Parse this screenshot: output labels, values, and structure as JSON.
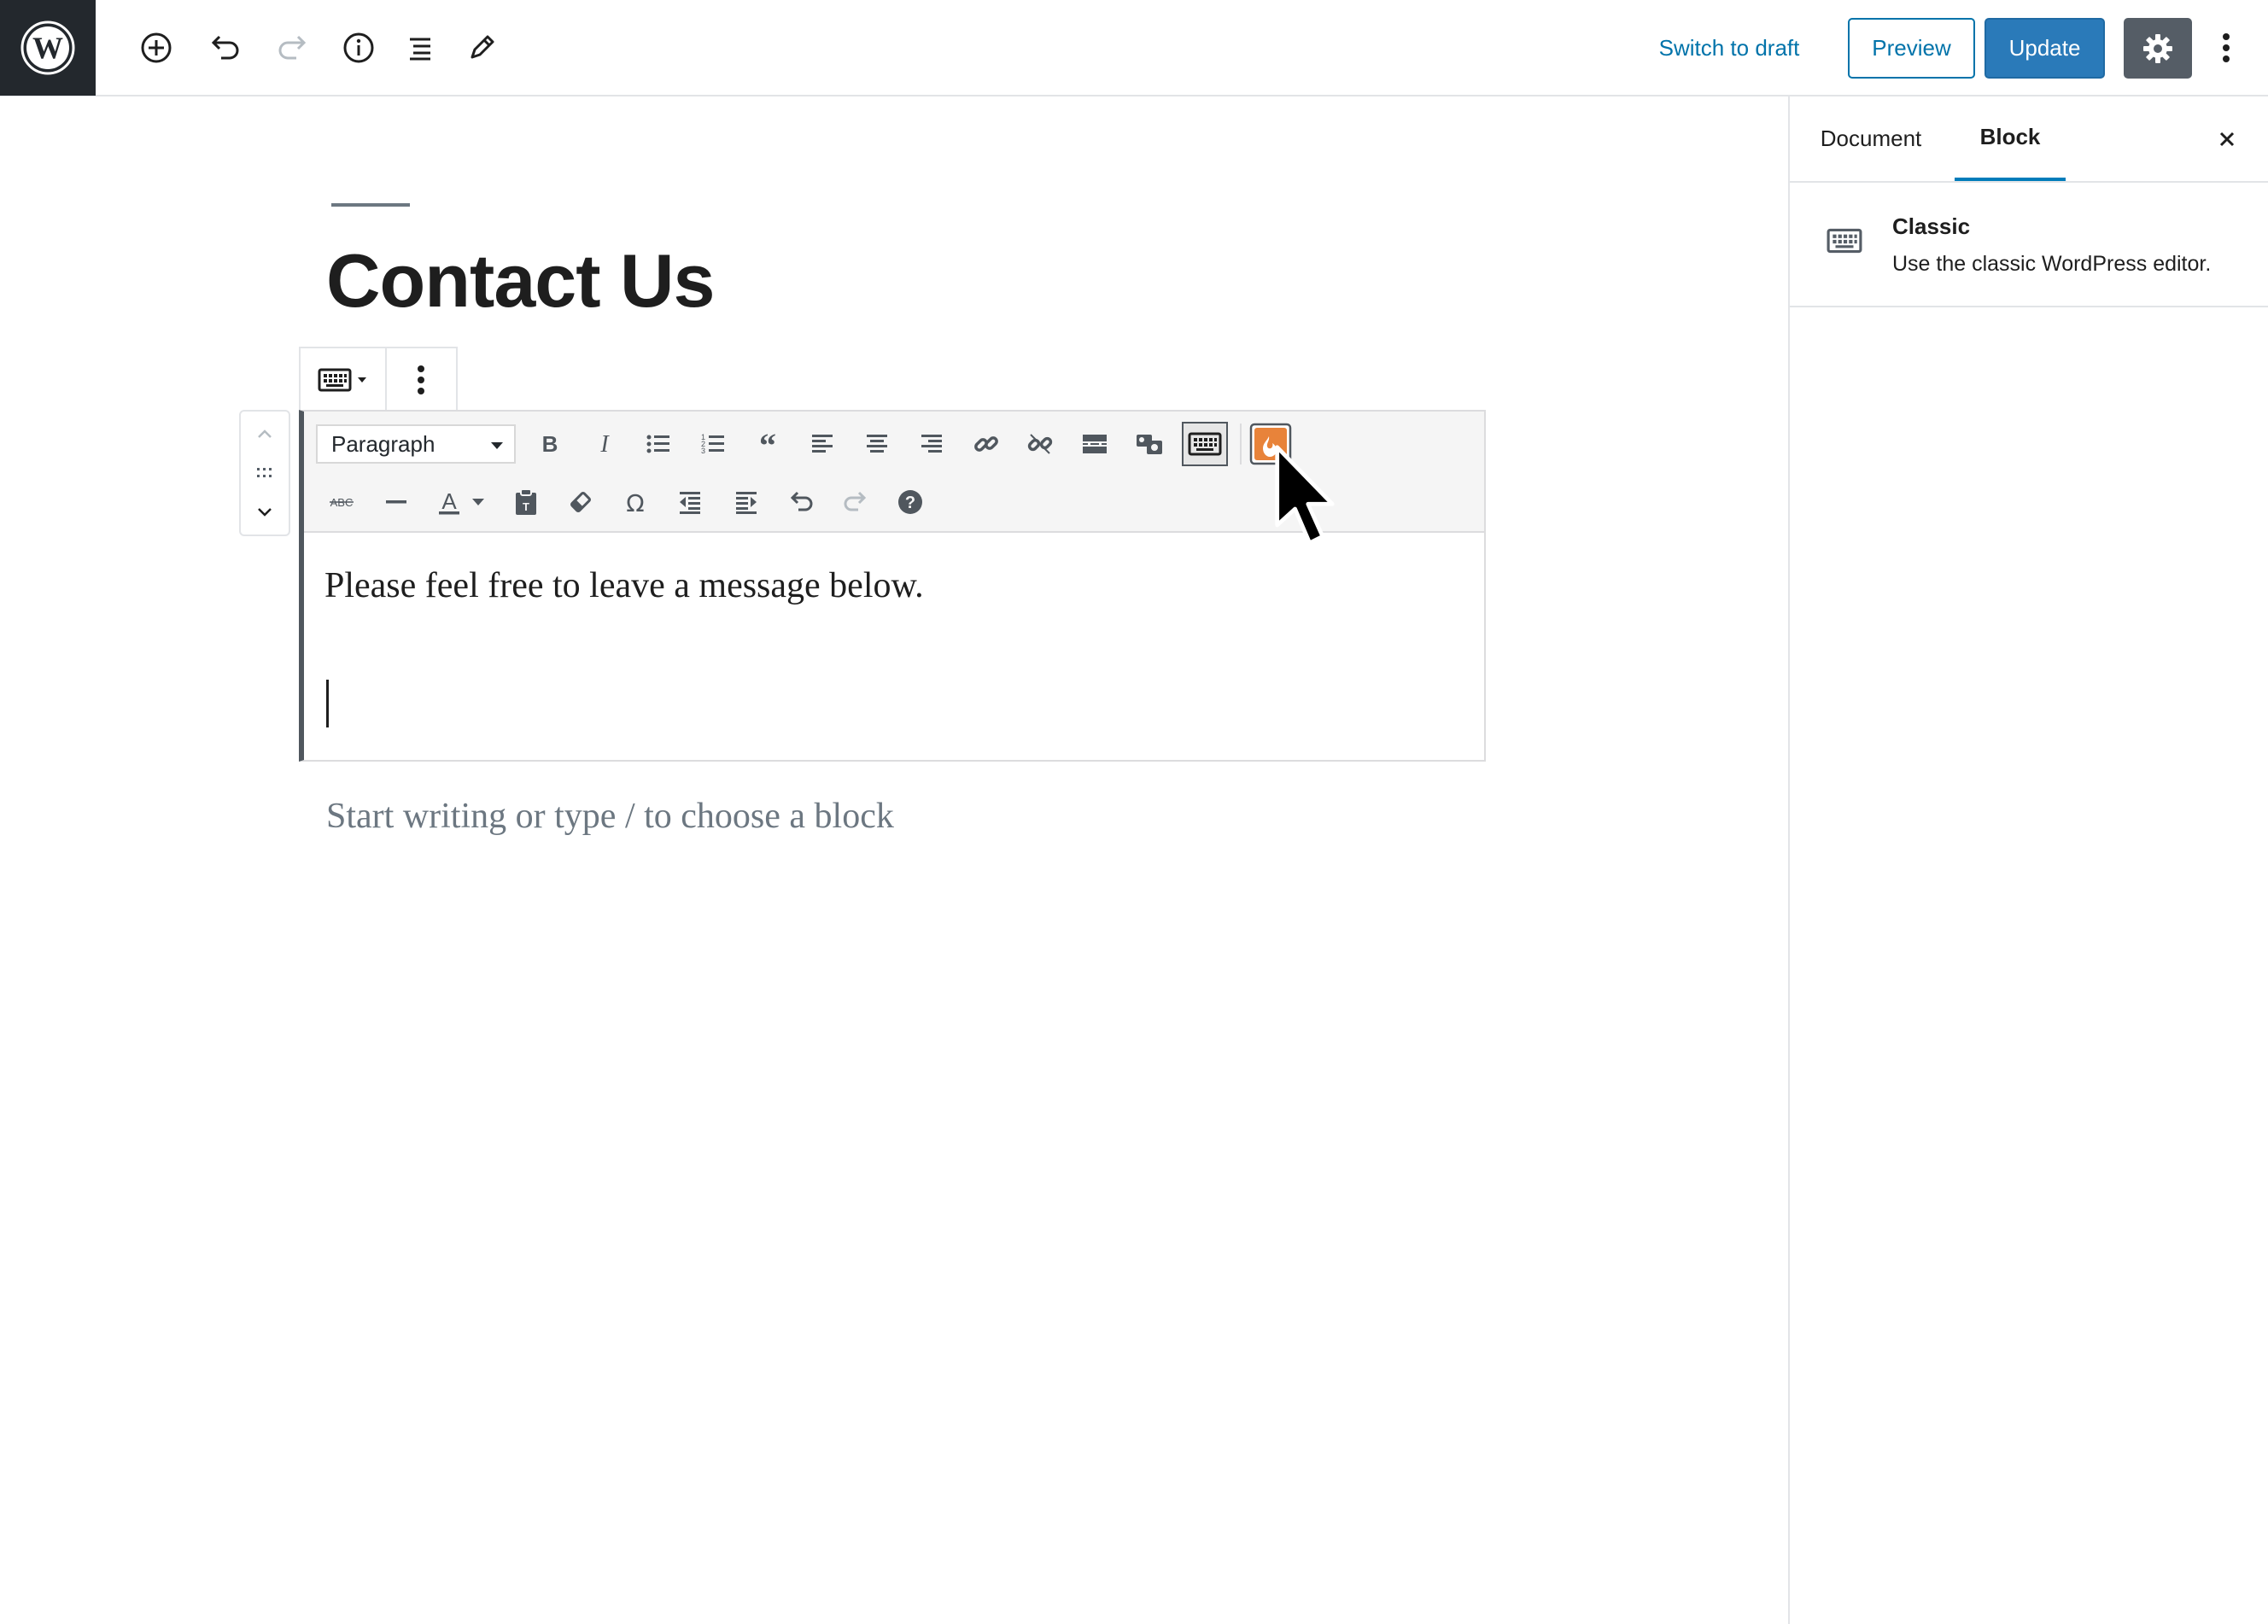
{
  "topbar": {
    "logo_icon": "wordpress-logo-icon",
    "add_block_icon": "plus-circle-icon",
    "undo_icon": "undo-icon",
    "redo_icon": "redo-icon",
    "info_icon": "info-icon",
    "outline_icon": "list-view-icon",
    "tools_icon": "pencil-icon",
    "switch_to_draft": "Switch to draft",
    "preview": "Preview",
    "update": "Update",
    "settings_icon": "gear-icon",
    "more_icon": "more-vertical-icon",
    "accent_color": "#0073aa",
    "update_color": "#2a7ab9"
  },
  "sidebar": {
    "tabs": [
      {
        "label": "Document",
        "active": false
      },
      {
        "label": "Block",
        "active": true
      }
    ],
    "close_icon": "close-icon",
    "block_card": {
      "icon": "keyboard-icon",
      "title": "Classic",
      "description": "Use the classic WordPress editor."
    }
  },
  "editor": {
    "post_title": "Contact Us",
    "block_toolbar": {
      "switcher_icon": "keyboard-icon",
      "more_icon": "more-vertical-icon"
    },
    "mover": {
      "up_icon": "chevron-up-icon",
      "drag_icon": "drag-handle-icon",
      "down_icon": "chevron-down-icon"
    },
    "classic_toolbar": {
      "format_value": "Paragraph",
      "row1": [
        "bold-icon",
        "italic-icon",
        "bullet-list-icon",
        "numbered-list-icon",
        "blockquote-icon",
        "align-left-icon",
        "align-center-icon",
        "align-right-icon",
        "link-icon",
        "unlink-icon",
        "read-more-icon",
        "add-media-icon",
        "toolbar-toggle-icon",
        "plugin-flame-icon"
      ],
      "row2": [
        "strikethrough-icon",
        "horizontal-line-icon",
        "text-color-icon",
        "paste-text-icon",
        "clear-formatting-icon",
        "special-character-icon",
        "outdent-icon",
        "indent-icon",
        "undo-icon",
        "redo-icon",
        "help-icon"
      ],
      "plugin_color": "#e8833a"
    },
    "content_text": "Please feel free to leave a message below.",
    "placeholder": "Start writing or type / to choose a block"
  }
}
